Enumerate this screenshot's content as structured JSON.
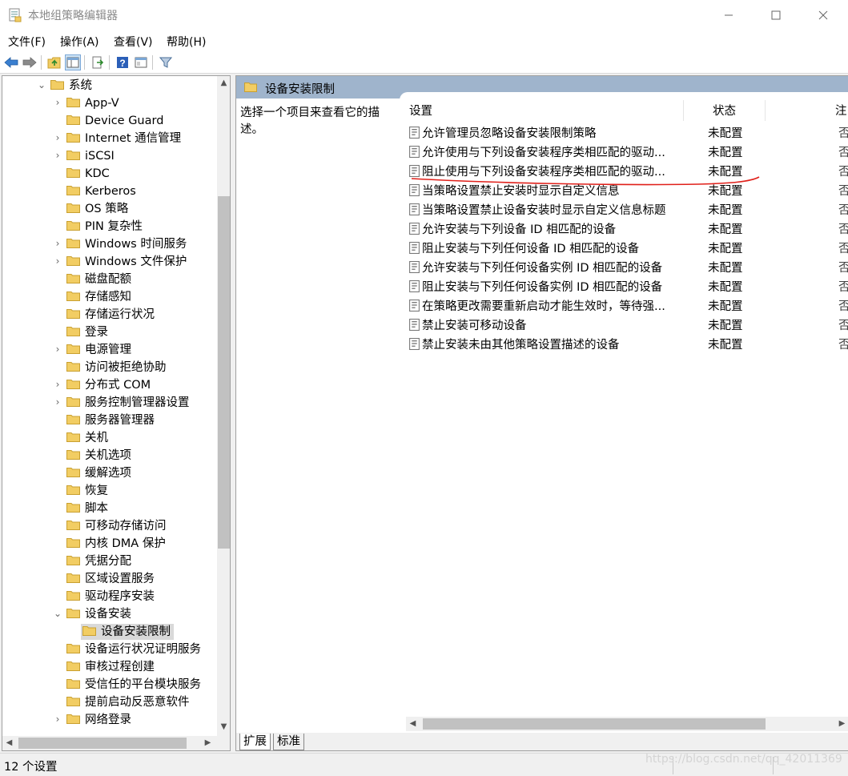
{
  "window": {
    "title": "本地组策略编辑器",
    "minimize_icon": "minimize-icon",
    "maximize_icon": "maximize-icon",
    "close_icon": "close-icon"
  },
  "menu": {
    "items": [
      "文件(F)",
      "操作(A)",
      "查看(V)",
      "帮助(H)"
    ]
  },
  "toolbar": {
    "icons": [
      "back-arrow-icon",
      "forward-arrow-icon",
      "up-folder-icon",
      "show-hide-tree-icon",
      "export-list-icon",
      "help-icon",
      "properties-icon",
      "filter-icon"
    ]
  },
  "tree": {
    "items": [
      {
        "label": "系统",
        "expander": "expanded",
        "level": 0
      },
      {
        "label": "App-V",
        "expander": "collapsed",
        "level": 1
      },
      {
        "label": "Device Guard",
        "expander": "none",
        "level": 1
      },
      {
        "label": "Internet 通信管理",
        "expander": "collapsed",
        "level": 1
      },
      {
        "label": "iSCSI",
        "expander": "collapsed",
        "level": 1
      },
      {
        "label": "KDC",
        "expander": "none",
        "level": 1
      },
      {
        "label": "Kerberos",
        "expander": "none",
        "level": 1
      },
      {
        "label": "OS 策略",
        "expander": "none",
        "level": 1
      },
      {
        "label": "PIN 复杂性",
        "expander": "none",
        "level": 1
      },
      {
        "label": "Windows 时间服务",
        "expander": "collapsed",
        "level": 1
      },
      {
        "label": "Windows 文件保护",
        "expander": "collapsed",
        "level": 1
      },
      {
        "label": "磁盘配额",
        "expander": "none",
        "level": 1
      },
      {
        "label": "存储感知",
        "expander": "none",
        "level": 1
      },
      {
        "label": "存储运行状况",
        "expander": "none",
        "level": 1
      },
      {
        "label": "登录",
        "expander": "none",
        "level": 1
      },
      {
        "label": "电源管理",
        "expander": "collapsed",
        "level": 1
      },
      {
        "label": "访问被拒绝协助",
        "expander": "none",
        "level": 1
      },
      {
        "label": "分布式 COM",
        "expander": "collapsed",
        "level": 1
      },
      {
        "label": "服务控制管理器设置",
        "expander": "collapsed",
        "level": 1
      },
      {
        "label": "服务器管理器",
        "expander": "none",
        "level": 1
      },
      {
        "label": "关机",
        "expander": "none",
        "level": 1
      },
      {
        "label": "关机选项",
        "expander": "none",
        "level": 1
      },
      {
        "label": "缓解选项",
        "expander": "none",
        "level": 1
      },
      {
        "label": "恢复",
        "expander": "none",
        "level": 1
      },
      {
        "label": "脚本",
        "expander": "none",
        "level": 1
      },
      {
        "label": "可移动存储访问",
        "expander": "none",
        "level": 1
      },
      {
        "label": "内核 DMA 保护",
        "expander": "none",
        "level": 1
      },
      {
        "label": "凭据分配",
        "expander": "none",
        "level": 1
      },
      {
        "label": "区域设置服务",
        "expander": "none",
        "level": 1
      },
      {
        "label": "驱动程序安装",
        "expander": "none",
        "level": 1
      },
      {
        "label": "设备安装",
        "expander": "expanded",
        "level": 1
      },
      {
        "label": "设备安装限制",
        "expander": "none",
        "level": 2,
        "selected": true
      },
      {
        "label": "设备运行状况证明服务",
        "expander": "none",
        "level": 1
      },
      {
        "label": "审核过程创建",
        "expander": "none",
        "level": 1
      },
      {
        "label": "受信任的平台模块服务",
        "expander": "none",
        "level": 1
      },
      {
        "label": "提前启动反恶意软件",
        "expander": "none",
        "level": 1
      },
      {
        "label": "网络登录",
        "expander": "collapsed",
        "level": 1
      }
    ]
  },
  "right_pane": {
    "header_title": "设备安装限制",
    "description": "选择一个项目来查看它的描述。",
    "columns": {
      "setting": "设置",
      "state": "状态",
      "comment_clipped": "注"
    },
    "rows": [
      {
        "name": "允许管理员忽略设备安装限制策略",
        "state": "未配置",
        "comment_clipped": "否"
      },
      {
        "name": "允许使用与下列设备安装程序类相匹配的驱动...",
        "state": "未配置",
        "comment_clipped": "否"
      },
      {
        "name": "阻止使用与下列设备安装程序类相匹配的驱动...",
        "state": "未配置",
        "comment_clipped": "否",
        "underlined": true
      },
      {
        "name": "当策略设置禁止安装时显示自定义信息",
        "state": "未配置",
        "comment_clipped": "否"
      },
      {
        "name": "当策略设置禁止设备安装时显示自定义信息标题",
        "state": "未配置",
        "comment_clipped": "否"
      },
      {
        "name": "允许安装与下列设备 ID 相匹配的设备",
        "state": "未配置",
        "comment_clipped": "否"
      },
      {
        "name": "阻止安装与下列任何设备 ID 相匹配的设备",
        "state": "未配置",
        "comment_clipped": "否"
      },
      {
        "name": "允许安装与下列任何设备实例 ID 相匹配的设备",
        "state": "未配置",
        "comment_clipped": "否"
      },
      {
        "name": "阻止安装与下列任何设备实例 ID 相匹配的设备",
        "state": "未配置",
        "comment_clipped": "否"
      },
      {
        "name": "在策略更改需要重新启动才能生效时，等待强...",
        "state": "未配置",
        "comment_clipped": "否"
      },
      {
        "name": "禁止安装可移动设备",
        "state": "未配置",
        "comment_clipped": "否"
      },
      {
        "name": "禁止安装未由其他策略设置描述的设备",
        "state": "未配置",
        "comment_clipped": "否"
      }
    ],
    "tabs": [
      {
        "label": "扩展",
        "active": true
      },
      {
        "label": "标准",
        "active": false
      }
    ]
  },
  "status": {
    "text": "12 个设置"
  },
  "watermark": "https://blog.csdn.net/qq_42011369",
  "colors": {
    "pane_header_bg": "#9fb4cc",
    "annotation_red": "#e0201a",
    "folder_yellow": "#f2cd63"
  }
}
